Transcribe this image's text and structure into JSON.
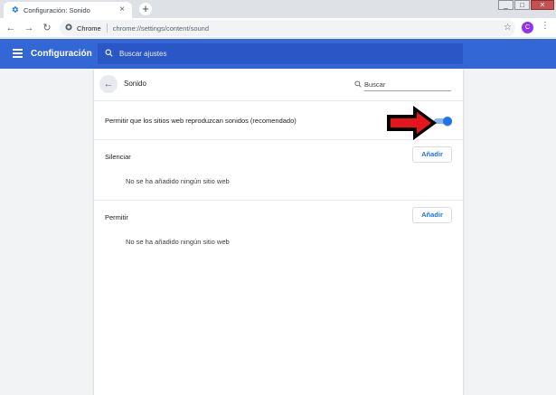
{
  "browser": {
    "tab_title": "Configuración: Sonido",
    "new_tab_label": "+",
    "window_controls": [
      "_",
      "□",
      "✕"
    ],
    "omnibox_site": "Chrome",
    "omnibox_url": "chrome://settings/content/sound",
    "avatar_letter": "C"
  },
  "settings": {
    "title": "Configuración",
    "search_placeholder": "Buscar ajustes",
    "accent_color": "#3367d6"
  },
  "subpage": {
    "title": "Sonido",
    "search_placeholder": "Buscar",
    "allow_sound_label": "Permitir que los sitios web reproduzcan sonidos (recomendado)",
    "allow_sound_enabled": true,
    "mute_section": {
      "title": "Silenciar",
      "add_label": "Añadir",
      "empty_message": "No se ha añadido ningún sitio web"
    },
    "allow_section": {
      "title": "Permitir",
      "add_label": "Añadir",
      "empty_message": "No se ha añadido ningún sitio web"
    }
  },
  "annotation": {
    "arrow_color": "#e8141b"
  }
}
